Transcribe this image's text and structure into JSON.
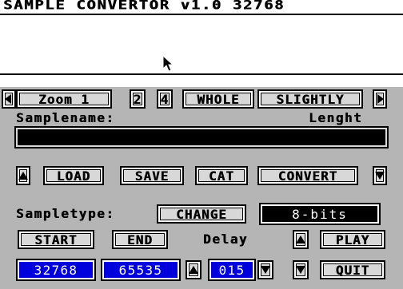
{
  "app": {
    "title": "SAMPLE CONVERTOR v1.0  32768"
  },
  "zoom_bar": {
    "left_arrow_icon": "arrow-left-icon",
    "zoom1_label": "Zoom 1",
    "zoom2_label": "2",
    "zoom4_label": "4",
    "whole_label": "WHOLE",
    "slightly_label": "SLIGHTLY",
    "right_arrow_icon": "arrow-right-icon"
  },
  "sample": {
    "name_label": "Samplename:",
    "length_label": "Lenght",
    "name_value": ""
  },
  "file_bar": {
    "up_icon": "arrow-up-icon",
    "load_label": "LOAD",
    "save_label": "SAVE",
    "cat_label": "CAT",
    "convert_label": "CONVERT",
    "down_icon": "arrow-down-icon"
  },
  "sampletype": {
    "label": "Sampletype:",
    "change_label": "CHANGE",
    "value": "8-bits"
  },
  "controls": {
    "start_label": "START",
    "end_label": "END",
    "delay_label": "Delay",
    "play_label": "PLAY",
    "quit_label": "QUIT",
    "start_value": "32768",
    "end_value": "65535",
    "delay_value": "015"
  },
  "colors": {
    "panel": "#b5b5b5",
    "button": "#d8d8d8",
    "value_field": "#0000dd"
  }
}
